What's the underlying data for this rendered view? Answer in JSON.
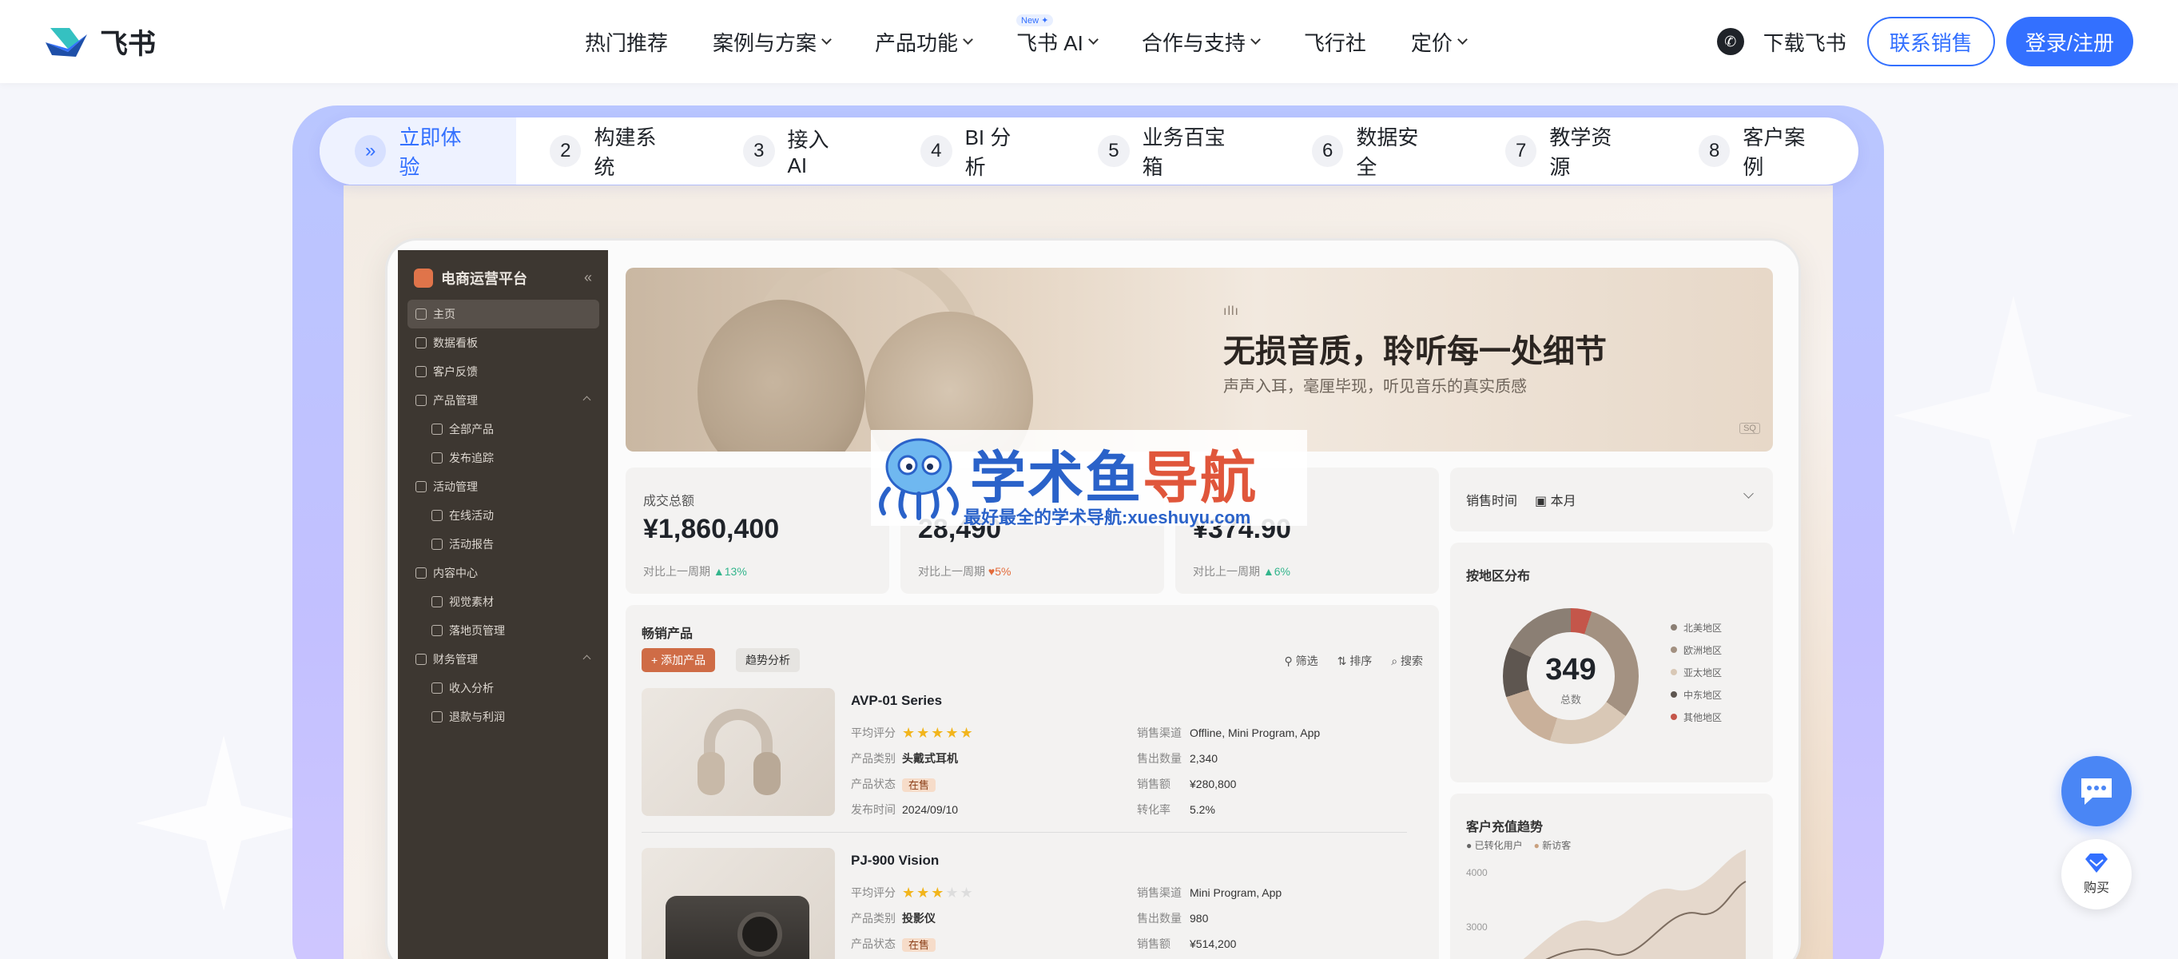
{
  "brand": {
    "name": "飞书"
  },
  "nav": {
    "items": [
      "热门推荐",
      "案例与方案",
      "产品功能",
      "飞书 AI",
      "合作与支持",
      "飞行社",
      "定价"
    ],
    "new_badge": "New ✦",
    "download": "下载飞书",
    "contact_sales": "联系销售",
    "login": "登录/注册"
  },
  "steps": [
    {
      "num": "»",
      "label": "立即体验"
    },
    {
      "num": "2",
      "label": "构建系统"
    },
    {
      "num": "3",
      "label": "接入 AI"
    },
    {
      "num": "4",
      "label": "BI 分析"
    },
    {
      "num": "5",
      "label": "业务百宝箱"
    },
    {
      "num": "6",
      "label": "数据安全"
    },
    {
      "num": "7",
      "label": "教学资源"
    },
    {
      "num": "8",
      "label": "客户案例"
    }
  ],
  "app": {
    "title": "电商运营平台",
    "sidebar": [
      {
        "label": "主页",
        "active": true
      },
      {
        "label": "数据看板"
      },
      {
        "label": "客户反馈"
      },
      {
        "label": "产品管理",
        "group": true
      },
      {
        "label": "全部产品",
        "sub": true
      },
      {
        "label": "发布追踪",
        "sub": true
      },
      {
        "label": "活动管理"
      },
      {
        "label": "在线活动",
        "sub": true
      },
      {
        "label": "活动报告",
        "sub": true
      },
      {
        "label": "内容中心"
      },
      {
        "label": "视觉素材",
        "sub": true
      },
      {
        "label": "落地页管理",
        "sub": true
      },
      {
        "label": "财务管理",
        "group": true
      },
      {
        "label": "收入分析",
        "sub": true
      },
      {
        "label": "退款与利润",
        "sub": true
      }
    ],
    "banner": {
      "wave": "ıllı",
      "title": "无损音质，聆听每一处细节",
      "subtitle": "声声入耳，毫厘毕现，听见音乐的真实质感",
      "badge": "SQ"
    },
    "kpis": [
      {
        "label": "成交总额",
        "value": "¥1,860,400",
        "cmp_label": "对比上一周期",
        "delta": "13%",
        "dir": "up"
      },
      {
        "label": "",
        "value": "28,490",
        "cmp_label": "对比上一周期",
        "delta": "5%",
        "dir": "down"
      },
      {
        "label": "",
        "value": "¥374.90",
        "cmp_label": "对比上一周期",
        "delta": "6%",
        "dir": "up"
      }
    ],
    "sales_time": {
      "label": "销售时间",
      "value": "本月"
    },
    "region": {
      "title": "按地区分布",
      "total": "349",
      "total_label": "总数",
      "legend": [
        {
          "name": "北美地区",
          "color": "#8b7f74"
        },
        {
          "name": "欧洲地区",
          "color": "#a39181"
        },
        {
          "name": "亚太地区",
          "color": "#d9c8b6"
        },
        {
          "name": "中东地区",
          "color": "#5e5650"
        },
        {
          "name": "其他地区",
          "color": "#c4564a"
        }
      ]
    },
    "trend": {
      "title": "客户充值趋势",
      "legend": [
        "已转化用户",
        "新访客"
      ],
      "y_ticks": [
        "4000",
        "3000"
      ]
    },
    "products_panel": {
      "title": "畅销产品",
      "add": "+ 添加产品",
      "trend": "趋势分析",
      "tools": [
        "筛选",
        "排序",
        "搜索"
      ]
    },
    "products": [
      {
        "name": "AVP-01 Series",
        "rating_label": "平均评分",
        "stars": "★★★★★",
        "empty_stars": "",
        "category_label": "产品类别",
        "category": "头戴式耳机",
        "status_label": "产品状态",
        "status": "在售",
        "date_label": "发布时间",
        "date": "2024/09/10",
        "channel_label": "销售渠道",
        "channel": "Offline, Mini Program, App",
        "sold_label": "售出数量",
        "sold": "2,340",
        "revenue_label": "销售额",
        "revenue": "¥280,800",
        "conv_label": "转化率",
        "conv": "5.2%"
      },
      {
        "name": "PJ-900 Vision",
        "rating_label": "平均评分",
        "stars": "★★★",
        "empty_stars": "★★",
        "category_label": "产品类别",
        "category": "投影仪",
        "status_label": "产品状态",
        "status": "在售",
        "channel_label": "销售渠道",
        "channel": "Mini Program, App",
        "sold_label": "售出数量",
        "sold": "980",
        "revenue_label": "销售额",
        "revenue": "¥514,200"
      }
    ]
  },
  "watermark": {
    "title_a": "学术鱼",
    "title_b": "导航",
    "subtitle": "最好最全的学术导航:xueshuyu.com"
  },
  "floating": {
    "buy": "购买"
  }
}
